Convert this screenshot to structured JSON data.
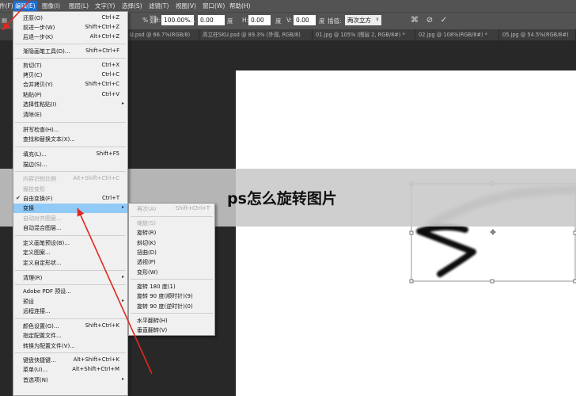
{
  "menubar": {
    "items": [
      {
        "label": "件(F)"
      },
      {
        "label": "编辑(E)"
      },
      {
        "label": "图像(I)"
      },
      {
        "label": "图层(L)"
      },
      {
        "label": "文字(Y)"
      },
      {
        "label": "选择(S)"
      },
      {
        "label": "滤镜(T)"
      },
      {
        "label": "视图(V)"
      },
      {
        "label": "窗口(W)"
      },
      {
        "label": "帮助(H)"
      }
    ]
  },
  "options": {
    "pct_sym": "%",
    "h_label": "H:",
    "h_value": "100.00%",
    "angle_icon": "angle-icon",
    "angle_value": "0.00",
    "deg1": "度",
    "h2_label": "H:",
    "h2_value": "0.00",
    "deg2": "度",
    "v_label": "V:",
    "v_value": "0.00",
    "deg3": "度",
    "interp_label": "插值:",
    "interp_value": "两次立方",
    "warp_icon": "warp-icon",
    "cancel_icon": "cancel-icon",
    "commit_icon": "commit-icon"
  },
  "tabs": [
    {
      "label": "U.psd @ 66.7%(RGB/8)"
    },
    {
      "label": "高立柱SKU.psd @ 89.3% (外观, RGB/8)"
    },
    {
      "label": "01.jpg @ 105% (图层 2, RGB/8#) *"
    },
    {
      "label": "02.jpg @ 108%(RGB/8#) *"
    },
    {
      "label": "05.jpg @ 54.5%(RGB/8#)"
    }
  ],
  "edit_menu": {
    "items": [
      {
        "label": "还原(O)",
        "shortcut": "Ctrl+Z"
      },
      {
        "label": "前进一步(W)",
        "shortcut": "Shift+Ctrl+Z"
      },
      {
        "label": "后退一步(K)",
        "shortcut": "Alt+Ctrl+Z"
      },
      {
        "label": "渐隐画笔工具(D)...",
        "shortcut": "Shift+Ctrl+F"
      },
      {
        "label": "剪切(T)",
        "shortcut": "Ctrl+X"
      },
      {
        "label": "拷贝(C)",
        "shortcut": "Ctrl+C"
      },
      {
        "label": "合并拷贝(Y)",
        "shortcut": "Shift+Ctrl+C"
      },
      {
        "label": "粘贴(P)",
        "shortcut": "Ctrl+V"
      },
      {
        "label": "选择性粘贴(I)",
        "shortcut": ""
      },
      {
        "label": "清除(E)",
        "shortcut": ""
      },
      {
        "label": "拼写检查(H)...",
        "shortcut": ""
      },
      {
        "label": "查找和替换文本(X)...",
        "shortcut": ""
      },
      {
        "label": "填充(L)...",
        "shortcut": "Shift+F5"
      },
      {
        "label": "描边(S)...",
        "shortcut": ""
      },
      {
        "label": "内容识别比例",
        "shortcut": "Alt+Shift+Ctrl+C"
      },
      {
        "label": "操控变形",
        "shortcut": ""
      },
      {
        "label": "自由变换(F)",
        "shortcut": "Ctrl+T"
      },
      {
        "label": "变换",
        "shortcut": ""
      },
      {
        "label": "自动对齐图层...",
        "shortcut": ""
      },
      {
        "label": "自动混合图层...",
        "shortcut": ""
      },
      {
        "label": "定义画笔预设(B)...",
        "shortcut": ""
      },
      {
        "label": "定义图案...",
        "shortcut": ""
      },
      {
        "label": "定义自定形状...",
        "shortcut": ""
      },
      {
        "label": "清理(R)",
        "shortcut": ""
      },
      {
        "label": "Adobe PDF 预设...",
        "shortcut": ""
      },
      {
        "label": "预设",
        "shortcut": ""
      },
      {
        "label": "远程连接...",
        "shortcut": ""
      },
      {
        "label": "颜色设置(G)...",
        "shortcut": "Shift+Ctrl+K"
      },
      {
        "label": "指定配置文件...",
        "shortcut": ""
      },
      {
        "label": "转换为配置文件(V)...",
        "shortcut": ""
      },
      {
        "label": "键盘快捷键...",
        "shortcut": "Alt+Shift+Ctrl+K"
      },
      {
        "label": "菜单(U)...",
        "shortcut": "Alt+Shift+Ctrl+M"
      },
      {
        "label": "首选项(N)",
        "shortcut": ""
      }
    ]
  },
  "transform_menu": {
    "items": [
      {
        "label": "再次(A)",
        "shortcut": "Shift+Ctrl+T"
      },
      {
        "label": "缩放(S)",
        "shortcut": ""
      },
      {
        "label": "旋转(R)",
        "shortcut": ""
      },
      {
        "label": "斜切(K)",
        "shortcut": ""
      },
      {
        "label": "扭曲(D)",
        "shortcut": ""
      },
      {
        "label": "透视(P)",
        "shortcut": ""
      },
      {
        "label": "变形(W)",
        "shortcut": ""
      },
      {
        "label": "旋转 180 度(1)",
        "shortcut": ""
      },
      {
        "label": "旋转 90 度(顺时针)(9)",
        "shortcut": ""
      },
      {
        "label": "旋转 90 度(逆时针)(0)",
        "shortcut": ""
      },
      {
        "label": "水平翻转(H)",
        "shortcut": ""
      },
      {
        "label": "垂直翻转(V)",
        "shortcut": ""
      }
    ]
  },
  "title": "ps怎么旋转图片",
  "colors": {
    "highlight": "#91c9f7",
    "arrow": "#e0281e",
    "menu_bg": "#f0f0f0",
    "app_bg": "#282828"
  }
}
